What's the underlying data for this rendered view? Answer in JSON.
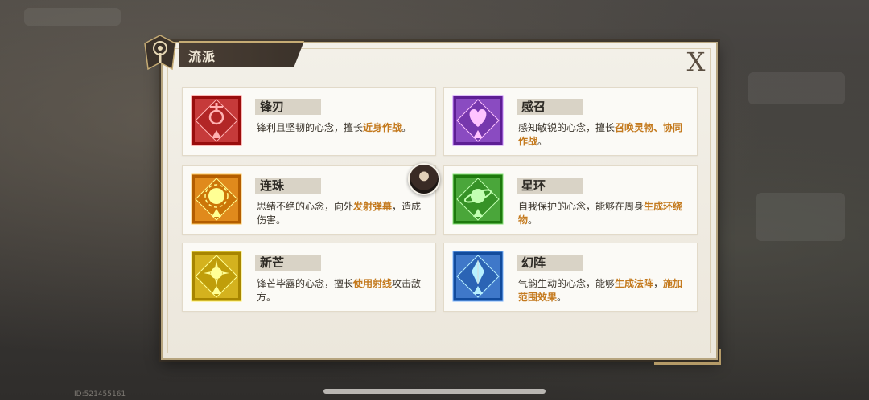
{
  "panel": {
    "title": "流派",
    "close_label": "X"
  },
  "cards": [
    {
      "name": "锋刃",
      "icon": "crimson-blade-emblem-icon",
      "color": "#c63a3a",
      "desc": [
        {
          "t": "锋利且坚韧的心念，擅长",
          "hl": false
        },
        {
          "t": "近身作战",
          "hl": true
        },
        {
          "t": "。",
          "hl": false
        }
      ]
    },
    {
      "name": "感召",
      "icon": "purple-heart-emblem-icon",
      "color": "#8a4bc1",
      "desc": [
        {
          "t": "感知敏锐的心念，擅长",
          "hl": false
        },
        {
          "t": "召唤灵物、协同作战",
          "hl": true
        },
        {
          "t": "。",
          "hl": false
        }
      ]
    },
    {
      "name": "连珠",
      "icon": "orange-orb-emblem-icon",
      "color": "#e08a1c",
      "desc": [
        {
          "t": "思绪不绝的心念，向外",
          "hl": false
        },
        {
          "t": "发射弹幕",
          "hl": true
        },
        {
          "t": "，造成伤害。",
          "hl": false
        }
      ]
    },
    {
      "name": "星环",
      "icon": "green-planet-emblem-icon",
      "color": "#4aa63a",
      "desc": [
        {
          "t": "自我保护的心念，能够在周身",
          "hl": false
        },
        {
          "t": "生成环绕物",
          "hl": true
        },
        {
          "t": "。",
          "hl": false
        }
      ]
    },
    {
      "name": "新芒",
      "icon": "golden-sun-emblem-icon",
      "color": "#d4b21e",
      "desc": [
        {
          "t": "锋芒毕露的心念，擅长",
          "hl": false
        },
        {
          "t": "使用射线",
          "hl": true
        },
        {
          "t": "攻击敌方。",
          "hl": false
        }
      ]
    },
    {
      "name": "幻阵",
      "icon": "blue-crystal-emblem-icon",
      "color": "#3f78c9",
      "desc": [
        {
          "t": "气韵生动的心念，能够",
          "hl": false
        },
        {
          "t": "生成法阵",
          "hl": true
        },
        {
          "t": "，",
          "hl": false
        },
        {
          "t": "施加范围效果",
          "hl": true
        },
        {
          "t": "。",
          "hl": false
        }
      ]
    }
  ],
  "footer": {
    "id_text": "ID:521455161"
  }
}
